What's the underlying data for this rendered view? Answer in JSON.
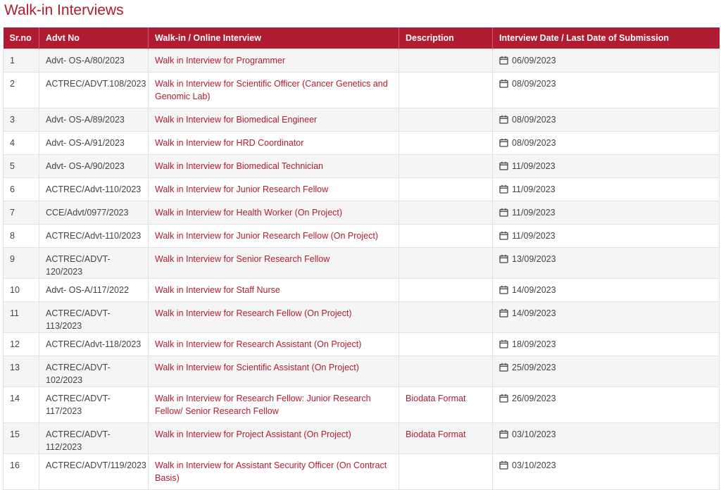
{
  "page_title": "Walk-in Interviews",
  "columns": {
    "srno": "Sr.no",
    "advt": "Advt No",
    "walkin": "Walk-in / Online Interview",
    "desc": "Description",
    "date": "Interview Date / Last Date of Submission"
  },
  "rows": [
    {
      "sr": "1",
      "advt": "Advt- OS-A/80/2023",
      "title": "Walk in Interview for Programmer",
      "desc": "",
      "date": "06/09/2023"
    },
    {
      "sr": "2",
      "advt": "ACTREC/ADVT.108/2023",
      "title": "Walk in Interview for Scientific Officer (Cancer Genetics and Genomic Lab)",
      "desc": "",
      "date": "08/09/2023"
    },
    {
      "sr": "3",
      "advt": "Advt- OS-A/89/2023",
      "title": "Walk in Interview for Biomedical Engineer",
      "desc": "",
      "date": "08/09/2023"
    },
    {
      "sr": "4",
      "advt": "Advt- OS-A/91/2023",
      "title": "Walk in Interview for HRD Coordinator",
      "desc": "",
      "date": "08/09/2023"
    },
    {
      "sr": "5",
      "advt": "Advt- OS-A/90/2023",
      "title": "Walk in Interview for Biomedical Technician",
      "desc": "",
      "date": "11/09/2023"
    },
    {
      "sr": "6",
      "advt": "ACTREC/Advt-110/2023",
      "title": "Walk in Interview for Junior Research Fellow",
      "desc": "",
      "date": "11/09/2023"
    },
    {
      "sr": "7",
      "advt": "CCE/Advt/0977/2023",
      "title": "Walk in Interview for Health Worker (On Project)",
      "desc": "",
      "date": "11/09/2023"
    },
    {
      "sr": "8",
      "advt": "ACTREC/Advt-110/2023",
      "title": "Walk in Interview for Junior Research Fellow (On Project)",
      "desc": "",
      "date": "11/09/2023"
    },
    {
      "sr": "9",
      "advt": "ACTREC/ADVT-120/2023",
      "title": "Walk in Interview for Senior Research Fellow",
      "desc": "",
      "date": "13/09/2023"
    },
    {
      "sr": "10",
      "advt": "Advt- OS-A/117/2022",
      "title": "Walk in Interview for Staff Nurse",
      "desc": "",
      "date": "14/09/2023"
    },
    {
      "sr": "11",
      "advt": "ACTREC/ADVT-113/2023",
      "title": "Walk in Interview for Research Fellow (On Project)",
      "desc": "",
      "date": "14/09/2023"
    },
    {
      "sr": "12",
      "advt": "ACTREC/Advt-118/2023",
      "title": "Walk in Interview for Research Assistant (On Project)",
      "desc": "",
      "date": "18/09/2023"
    },
    {
      "sr": "13",
      "advt": "ACTREC/ADVT-102/2023",
      "title": "Walk in Interview for Scientific Assistant (On Project)",
      "desc": "",
      "date": "25/09/2023"
    },
    {
      "sr": "14",
      "advt": "ACTREC/ADVT-117/2023",
      "title": "Walk in Interview for Research Fellow: Junior Research Fellow/ Senior Research Fellow",
      "desc": "Biodata Format",
      "date": "26/09/2023"
    },
    {
      "sr": "15",
      "advt": "ACTREC/ADVT-112/2023",
      "title": "Walk in Interview for Project Assistant (On Project)",
      "desc": "Biodata Format",
      "date": "03/10/2023"
    },
    {
      "sr": "16",
      "advt": "ACTREC/ADVT/119/2023",
      "title": "Walk in Interview for Assistant Security Officer (On Contract Basis)",
      "desc": "",
      "date": "03/10/2023"
    }
  ],
  "icons": {
    "date": "calendar-icon"
  },
  "colors": {
    "accent": "#b01c32"
  }
}
